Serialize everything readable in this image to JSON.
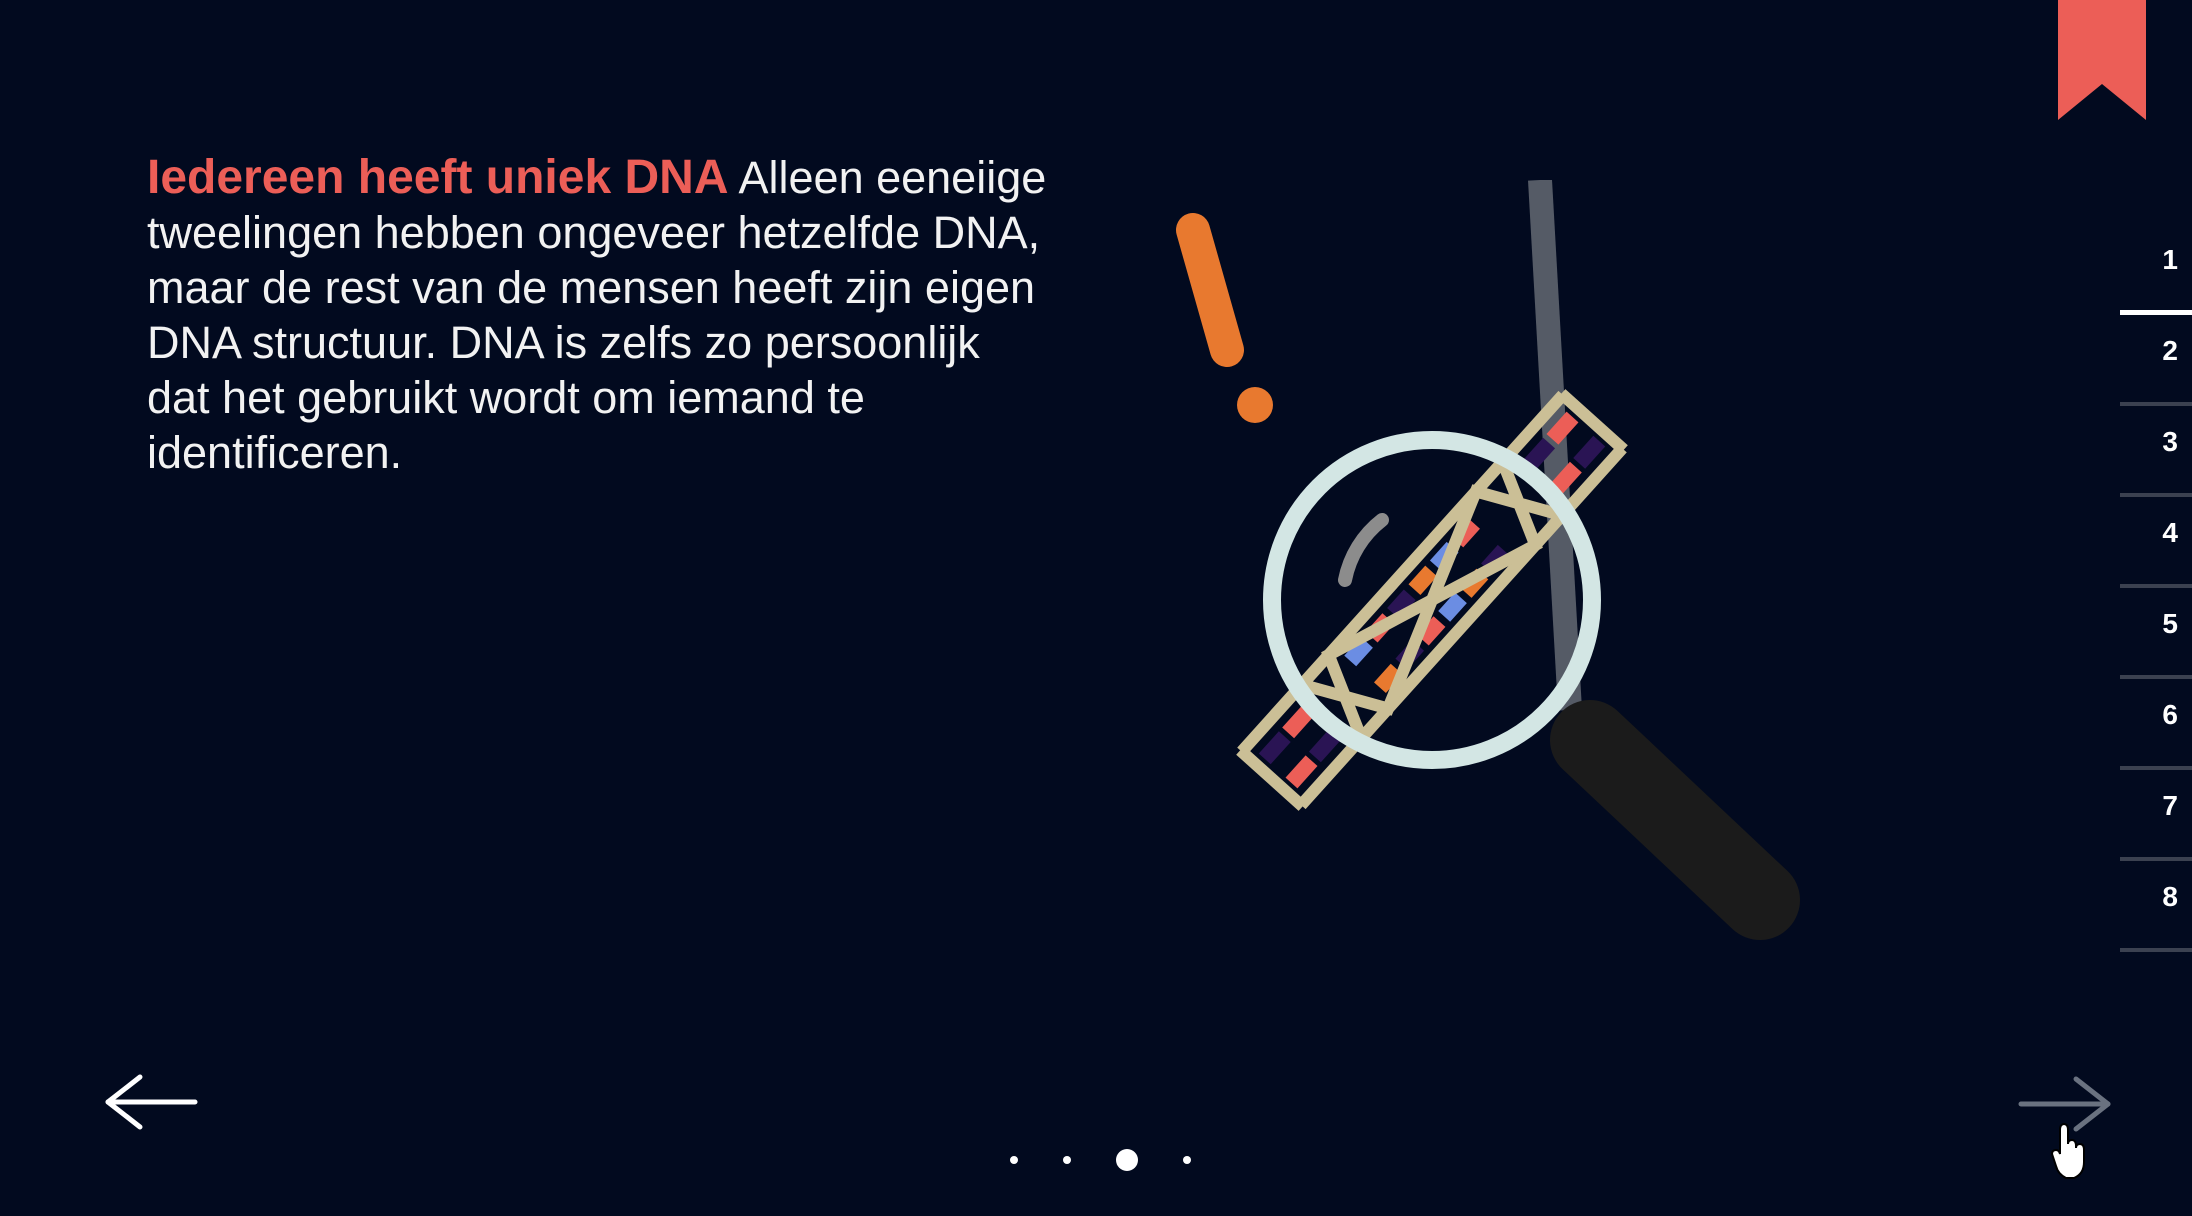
{
  "content": {
    "headline": "Iedereen heeft uniek DNA",
    "body": " Alleen eeneiige tweelingen hebben ongeveer hetzelfde DNA, maar de rest van de mensen heeft zijn eigen DNA structuur. DNA is zelfs zo persoonlijk dat het gebruikt wordt om iemand te identificeren."
  },
  "chapters": [
    {
      "label": "1",
      "active": true
    },
    {
      "label": "2"
    },
    {
      "label": "3"
    },
    {
      "label": "4"
    },
    {
      "label": "5"
    },
    {
      "label": "6"
    },
    {
      "label": "7"
    },
    {
      "label": "8"
    }
  ],
  "pager": {
    "total": 4,
    "current": 3
  },
  "icons": {
    "bookmark": "bookmark-icon",
    "prev": "arrow-left-icon",
    "next": "arrow-right-icon",
    "illustration": "dna-magnifier-illustration"
  },
  "colors": {
    "background": "#020a1f",
    "accent": "#ec5e57",
    "orange": "#e8792f",
    "text": "#f2f2f2"
  }
}
